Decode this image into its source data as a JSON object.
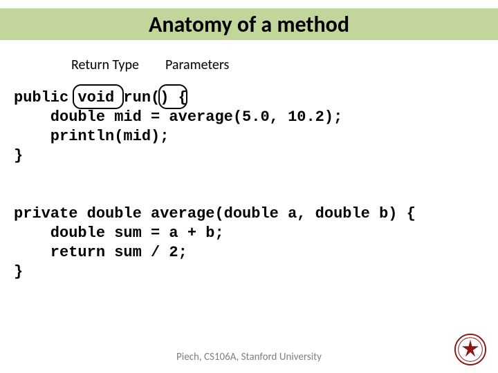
{
  "title": "Anatomy of a method",
  "labels": {
    "return_type": "Return Type",
    "parameters": "Parameters"
  },
  "code": "public void run() {\n    double mid = average(5.0, 10.2);\n    println(mid);\n}\n\n\nprivate double average(double a, double b) {\n    double sum = a + b;\n    return sum / 2;\n}",
  "footer": "Piech, CS106A, Stanford University"
}
